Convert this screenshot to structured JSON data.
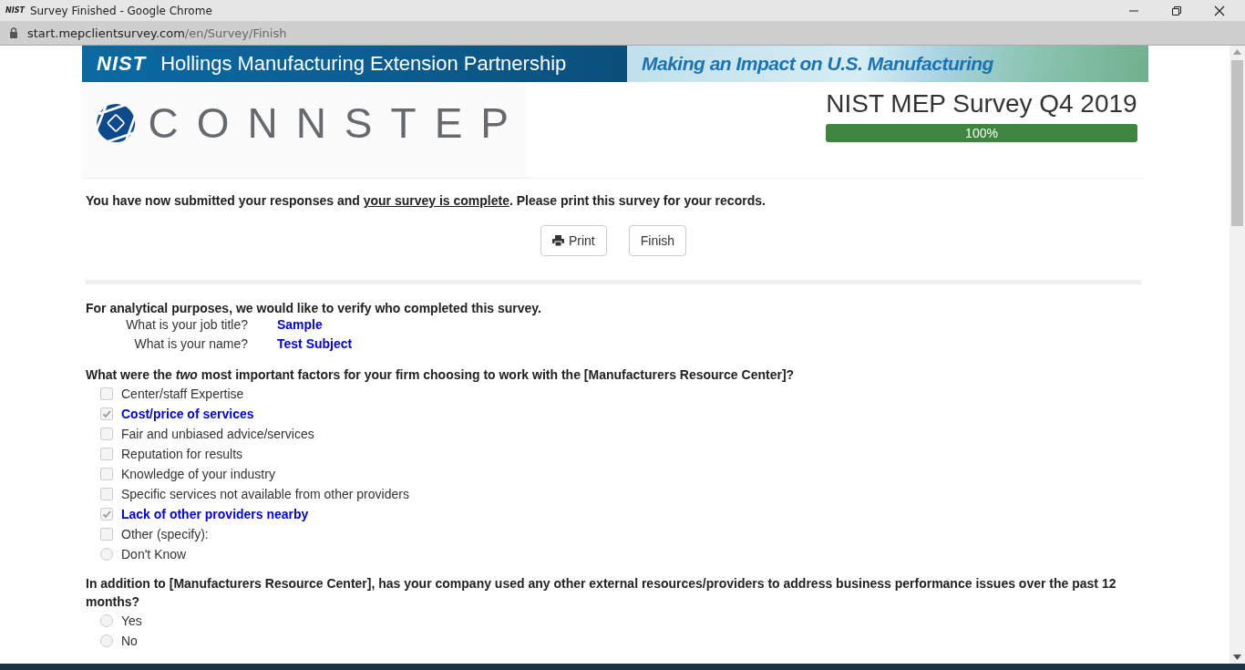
{
  "window": {
    "title": "Survey Finished - Google Chrome",
    "favicon": "NIST",
    "url_host": "start.mepclientsurvey.com",
    "url_path": "/en/Survey/Finish"
  },
  "banner": {
    "logo": "NIST",
    "title": "Hollings Manufacturing Extension Partnership",
    "tagline": "Making an Impact on U.S. Manufacturing"
  },
  "brand": {
    "name": "CONNSTEP"
  },
  "survey": {
    "title": "NIST MEP Survey Q4 2019",
    "progress_label": "100%",
    "level": 1
  },
  "message": {
    "before": "You have now submitted your responses and ",
    "underlined": "your survey is complete",
    "after": ". Please print this survey for your records."
  },
  "buttons": [
    {
      "label": "Print",
      "kind": "print"
    },
    {
      "label": "Finish",
      "kind": "plain"
    }
  ],
  "verify": {
    "heading": "For analytical purposes, we would like to verify who completed this survey.",
    "fields": [
      {
        "label": "What is your job title?",
        "value": "Sample"
      },
      {
        "label": "What is your name?",
        "value": "Test Subject"
      }
    ]
  },
  "questions": [
    {
      "text": "What were the *two* most important factors for your firm choosing to work with the [Manufacturers Resource Center]?",
      "options": [
        {
          "label": "Center/staff Expertise",
          "kind": "checkbox",
          "checked": false
        },
        {
          "label": "Cost/price of services",
          "kind": "checkbox",
          "checked": true
        },
        {
          "label": "Fair and unbiased advice/services",
          "kind": "checkbox",
          "checked": false
        },
        {
          "label": "Reputation for results",
          "kind": "checkbox",
          "checked": false
        },
        {
          "label": "Knowledge of your industry",
          "kind": "checkbox",
          "checked": false
        },
        {
          "label": "Specific services not available from other providers",
          "kind": "checkbox",
          "checked": false
        },
        {
          "label": "Lack of other providers nearby",
          "kind": "checkbox",
          "checked": true
        },
        {
          "label": "Other (specify):",
          "kind": "checkbox",
          "checked": false
        },
        {
          "label": "Don't Know",
          "kind": "radio",
          "checked": false
        }
      ]
    },
    {
      "text": "In addition to [Manufacturers Resource Center], has your company used any other external resources/providers to address business performance issues over the past 12 months?",
      "options": [
        {
          "label": "Yes",
          "kind": "radio",
          "checked": false
        },
        {
          "label": "No",
          "kind": "radio",
          "checked": false
        }
      ]
    }
  ]
}
